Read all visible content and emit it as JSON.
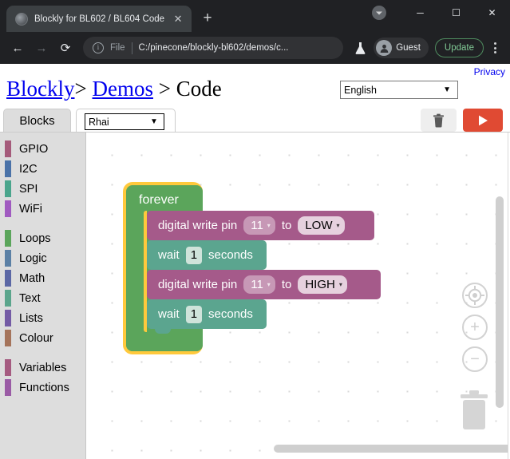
{
  "browser": {
    "tab": {
      "title": "Blockly for BL602 / BL604 Code",
      "close_label": "✕",
      "favicon": "globe-icon"
    },
    "new_tab_label": "+",
    "window_controls": {
      "minimize": "─",
      "maximize": "☐",
      "close": "✕"
    },
    "nav": {
      "back": "←",
      "forward": "→",
      "reload": "⟳"
    },
    "omnibox": {
      "scheme_label": "File",
      "url": "C:/pinecone/blockly-bl602/demos/c...",
      "info_icon": "info-icon"
    },
    "flask_icon": "flask-icon",
    "profile": {
      "label": "Guest",
      "avatar_icon": "person-icon"
    },
    "update_label": "Update",
    "menu_icon": "kebab-menu-icon",
    "colors": {
      "chrome_bg": "#202124",
      "tab_bg": "#3c4043",
      "update_green": "#81c995"
    }
  },
  "page": {
    "privacy_link": "Privacy",
    "breadcrumb": {
      "part1": "Blockly",
      "sep1": ">",
      "part2": "Demos",
      "sep2": ">",
      "part3": "Code"
    },
    "language_select": {
      "value": "English",
      "options": [
        "English"
      ]
    }
  },
  "tabs": {
    "blocks_label": "Blocks",
    "code_lang_select": {
      "value": "Rhai",
      "options": [
        "Rhai"
      ]
    },
    "trash_icon": "trash-icon",
    "run_icon": "play-icon",
    "colors": {
      "run_red": "#e04a33",
      "tab_active_bg": "#dddddd"
    }
  },
  "toolbox": {
    "groups": [
      {
        "items": [
          {
            "label": "GPIO",
            "color": "#a55a7a"
          },
          {
            "label": "I2C",
            "color": "#4a72a8"
          },
          {
            "label": "SPI",
            "color": "#4aa58c"
          },
          {
            "label": "WiFi",
            "color": "#a05ac0"
          }
        ]
      },
      {
        "items": [
          {
            "label": "Loops",
            "color": "#5ba55b"
          },
          {
            "label": "Logic",
            "color": "#5b80a5"
          },
          {
            "label": "Math",
            "color": "#5b67a5"
          },
          {
            "label": "Text",
            "color": "#5ba58c"
          },
          {
            "label": "Lists",
            "color": "#745ba5"
          },
          {
            "label": "Colour",
            "color": "#a5745b"
          }
        ]
      },
      {
        "items": [
          {
            "label": "Variables",
            "color": "#a55b80"
          },
          {
            "label": "Functions",
            "color": "#9a5ba5"
          }
        ]
      }
    ]
  },
  "workspace": {
    "blocks": {
      "forever": {
        "label": "forever",
        "color": "#5ba55b",
        "selected": true,
        "highlight_color": "#ffc93c"
      },
      "rows": [
        {
          "type": "digital-write",
          "color": "#a55a8a",
          "text_before": "digital write pin",
          "pin_value": "11",
          "text_middle": "to",
          "level_value": "LOW",
          "caret": "▾"
        },
        {
          "type": "wait",
          "color": "#5ba58f",
          "text_before": "wait",
          "number_value": "1",
          "text_after": "seconds"
        },
        {
          "type": "digital-write",
          "color": "#a55a8a",
          "text_before": "digital write pin",
          "pin_value": "11",
          "text_middle": "to",
          "level_value": "HIGH",
          "caret": "▾"
        },
        {
          "type": "wait",
          "color": "#5ba58f",
          "text_before": "wait",
          "number_value": "1",
          "text_after": "seconds"
        }
      ]
    },
    "controls": {
      "center_icon": "target-crosshair-icon",
      "zoom_in": "+",
      "zoom_out": "−",
      "trash_icon": "trash-icon"
    },
    "scrollbars": {
      "vertical": "vertical-scrollbar",
      "horizontal": "horizontal-scrollbar"
    }
  }
}
